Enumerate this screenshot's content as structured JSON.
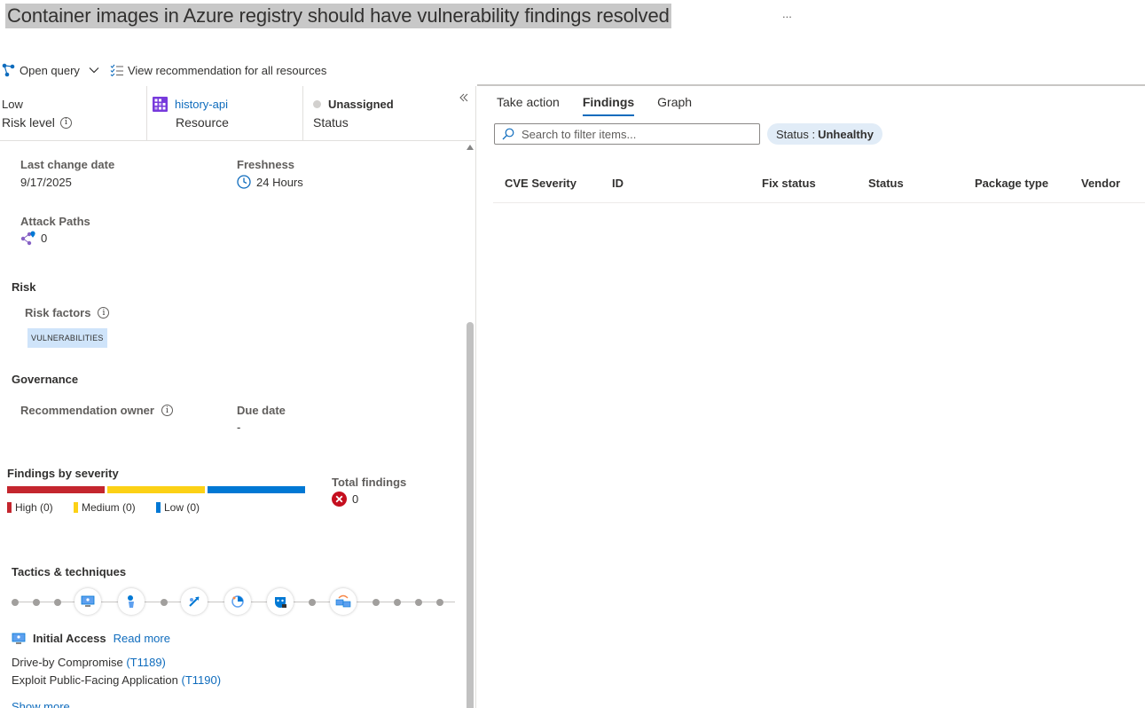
{
  "page": {
    "title": "Container images in Azure registry should have vulnerability findings resolved",
    "more": "..."
  },
  "toolbar": {
    "open_query": "Open query",
    "view_all": "View recommendation for all resources"
  },
  "summary": {
    "risk_value": "Low",
    "risk_label": "Risk level",
    "resource_value": "history-api",
    "resource_label": "Resource",
    "status_value": "Unassigned",
    "status_label": "Status"
  },
  "details": {
    "last_change_label": "Last change date",
    "last_change_value": "9/17/2025",
    "freshness_label": "Freshness",
    "freshness_value": "24 Hours",
    "attack_paths_label": "Attack Paths",
    "attack_paths_value": "0"
  },
  "risk": {
    "heading": "Risk",
    "factors_label": "Risk factors",
    "factor_chip": "VULNERABILITIES"
  },
  "governance": {
    "heading": "Governance",
    "owner_label": "Recommendation owner",
    "due_label": "Due date",
    "due_value": "-"
  },
  "findings": {
    "heading": "Findings by severity",
    "high": "High (0)",
    "medium": "Medium (0)",
    "low": "Low (0)",
    "total_label": "Total findings",
    "total_value": "0",
    "colors": {
      "high": "#c4262e",
      "medium": "#fcd116",
      "low": "#0078d4"
    }
  },
  "tactics": {
    "heading": "Tactics & techniques",
    "selected": "Initial Access",
    "read_more": "Read more",
    "techniques": [
      {
        "name": "Drive-by Compromise",
        "id": "(T1189)"
      },
      {
        "name": "Exploit Public-Facing Application",
        "id": "(T1190)"
      }
    ],
    "show_more": "Show more"
  },
  "right": {
    "tabs": [
      "Take action",
      "Findings",
      "Graph"
    ],
    "search_placeholder": "Search to filter items...",
    "filter_key": "Status : ",
    "filter_value": "Unhealthy",
    "columns": [
      "CVE Severity",
      "ID",
      "Fix status",
      "Status",
      "Package type",
      "Vendor"
    ]
  },
  "colors": {
    "accent": "#0f6cbd",
    "purple": "#8661c5"
  }
}
